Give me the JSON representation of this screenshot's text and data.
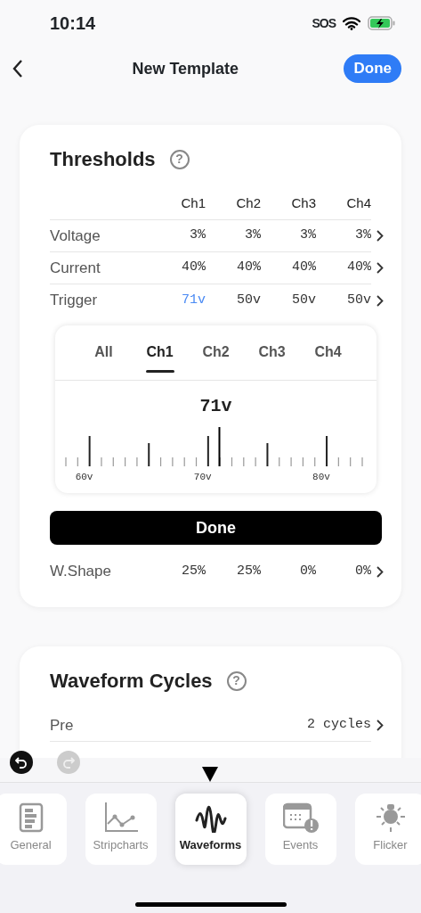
{
  "status_bar": {
    "time": "10:14",
    "carrier": "SOS"
  },
  "nav": {
    "title": "New Template",
    "done": "Done"
  },
  "thresholds": {
    "title": "Thresholds",
    "help": "?",
    "columns": [
      "Ch1",
      "Ch2",
      "Ch3",
      "Ch4"
    ],
    "rows": [
      {
        "label": "Voltage",
        "cells": [
          {
            "text": "3%",
            "selected": false
          },
          {
            "text": "3%",
            "selected": false
          },
          {
            "text": "3%",
            "selected": false
          },
          {
            "text": "3%",
            "selected": false
          }
        ]
      },
      {
        "label": "Current",
        "cells": [
          {
            "text": "40%",
            "selected": false
          },
          {
            "text": "40%",
            "selected": false
          },
          {
            "text": "40%",
            "selected": false
          },
          {
            "text": "40%",
            "selected": false
          }
        ]
      },
      {
        "label": "Trigger",
        "cells": [
          {
            "text": "71v",
            "selected": true
          },
          {
            "text": "50v",
            "selected": false
          },
          {
            "text": "50v",
            "selected": false
          },
          {
            "text": "50v",
            "selected": false
          }
        ]
      }
    ],
    "picker": {
      "tabs": [
        {
          "label": "All",
          "selected": false
        },
        {
          "label": "Ch1",
          "selected": true
        },
        {
          "label": "Ch2",
          "selected": false
        },
        {
          "label": "Ch3",
          "selected": false
        },
        {
          "label": "Ch4",
          "selected": false
        }
      ],
      "value": "71v",
      "level": 0.518,
      "ruler_labels": [
        "60v",
        "70v",
        "80v"
      ],
      "done": "Done"
    },
    "after_rows": [
      {
        "label": "W.Shape",
        "cells": [
          {
            "text": "25%",
            "selected": false
          },
          {
            "text": "25%",
            "selected": false
          },
          {
            "text": "0%",
            "selected": false
          },
          {
            "text": "0%",
            "selected": false
          }
        ]
      }
    ]
  },
  "waveform_cycles": {
    "title": "Waveform Cycles",
    "help": "?",
    "rows": [
      {
        "label": "Pre",
        "value": "2 cycles"
      }
    ]
  },
  "toolbar": {
    "undo_enabled": true,
    "redo_enabled": false
  },
  "tabs": [
    {
      "label": "General",
      "kind": "general",
      "selected": false
    },
    {
      "label": "Stripcharts",
      "kind": "stripcharts",
      "selected": false
    },
    {
      "label": "Waveforms",
      "kind": "waveforms",
      "selected": true
    },
    {
      "label": "Events",
      "kind": "events",
      "selected": false
    },
    {
      "label": "Flicker",
      "kind": "flicker",
      "selected": false
    }
  ]
}
